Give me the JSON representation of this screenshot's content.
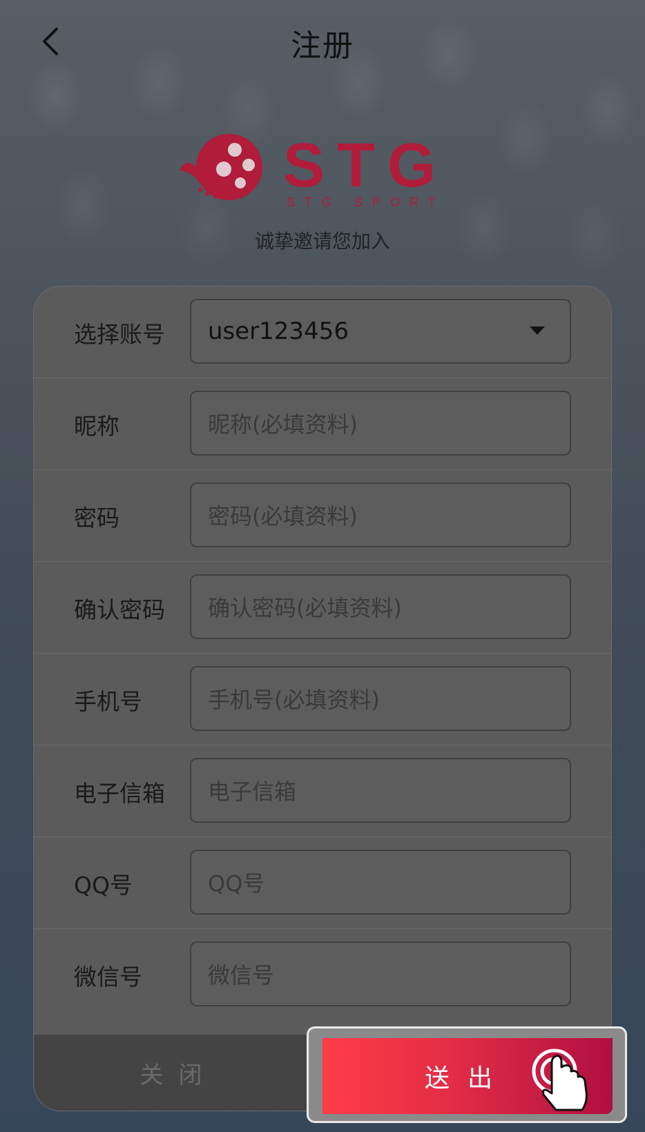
{
  "header": {
    "title": "注册"
  },
  "logo": {
    "brand": "STG",
    "sub": "STG SPORT"
  },
  "invite_text": "诚挚邀请您加入",
  "form": {
    "rows": [
      {
        "label": "选择账号",
        "value": "user123456",
        "placeholder": ""
      },
      {
        "label": "昵称",
        "value": "",
        "placeholder": "昵称(必填资料)"
      },
      {
        "label": "密码",
        "value": "",
        "placeholder": "密码(必填资料)"
      },
      {
        "label": "确认密码",
        "value": "",
        "placeholder": "确认密码(必填资料)"
      },
      {
        "label": "手机号",
        "value": "",
        "placeholder": "手机号(必填资料)"
      },
      {
        "label": "电子信箱",
        "value": "",
        "placeholder": "电子信箱"
      },
      {
        "label": "QQ号",
        "value": "",
        "placeholder": "QQ号"
      },
      {
        "label": "微信号",
        "value": "",
        "placeholder": "微信号"
      }
    ]
  },
  "footer": {
    "close_label": "关闭",
    "submit_label": "送出"
  },
  "colors": {
    "brand": "#b01c3a",
    "submit_start": "#ff3d47",
    "submit_end": "#b00f42"
  },
  "icons": {
    "back": "chevron-left-icon",
    "dropdown": "caret-down-icon",
    "tap": "tap-hand-icon"
  }
}
